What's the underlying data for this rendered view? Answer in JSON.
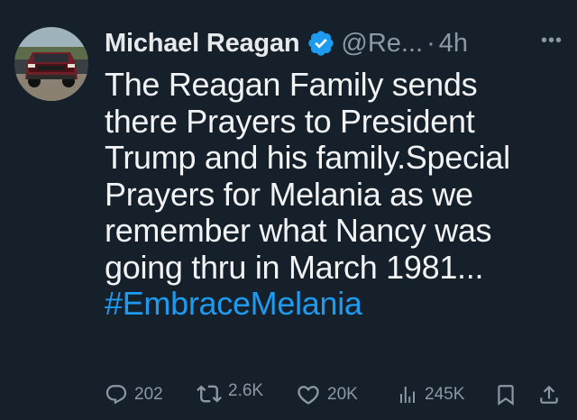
{
  "tweet": {
    "author": {
      "display_name": "Michael Reagan",
      "handle": "@Re...",
      "verified_icon": "verified-badge-icon"
    },
    "separator": "·",
    "timestamp": "4h",
    "more_icon": "more-options-icon",
    "text_lines": [
      "The Reagan Family sends",
      "there Prayers to President",
      "Trump and his family.Special",
      "Prayers for Melania as we",
      "remember what Nancy was",
      "going thru in March 1981..."
    ],
    "hashtag": "#EmbraceMelania",
    "actions": {
      "reply": {
        "icon": "reply-icon",
        "count": "202"
      },
      "retweet": {
        "icon": "retweet-icon",
        "count": "2.6K"
      },
      "like": {
        "icon": "heart-icon",
        "count": "20K"
      },
      "views": {
        "icon": "views-chart-icon",
        "count": "245K"
      },
      "bookmark": {
        "icon": "bookmark-icon"
      },
      "share": {
        "icon": "share-icon"
      }
    }
  },
  "colors": {
    "background": "#15202b",
    "text": "#e7e9ea",
    "muted": "#8b98a5",
    "accent": "#1d9bf0"
  }
}
